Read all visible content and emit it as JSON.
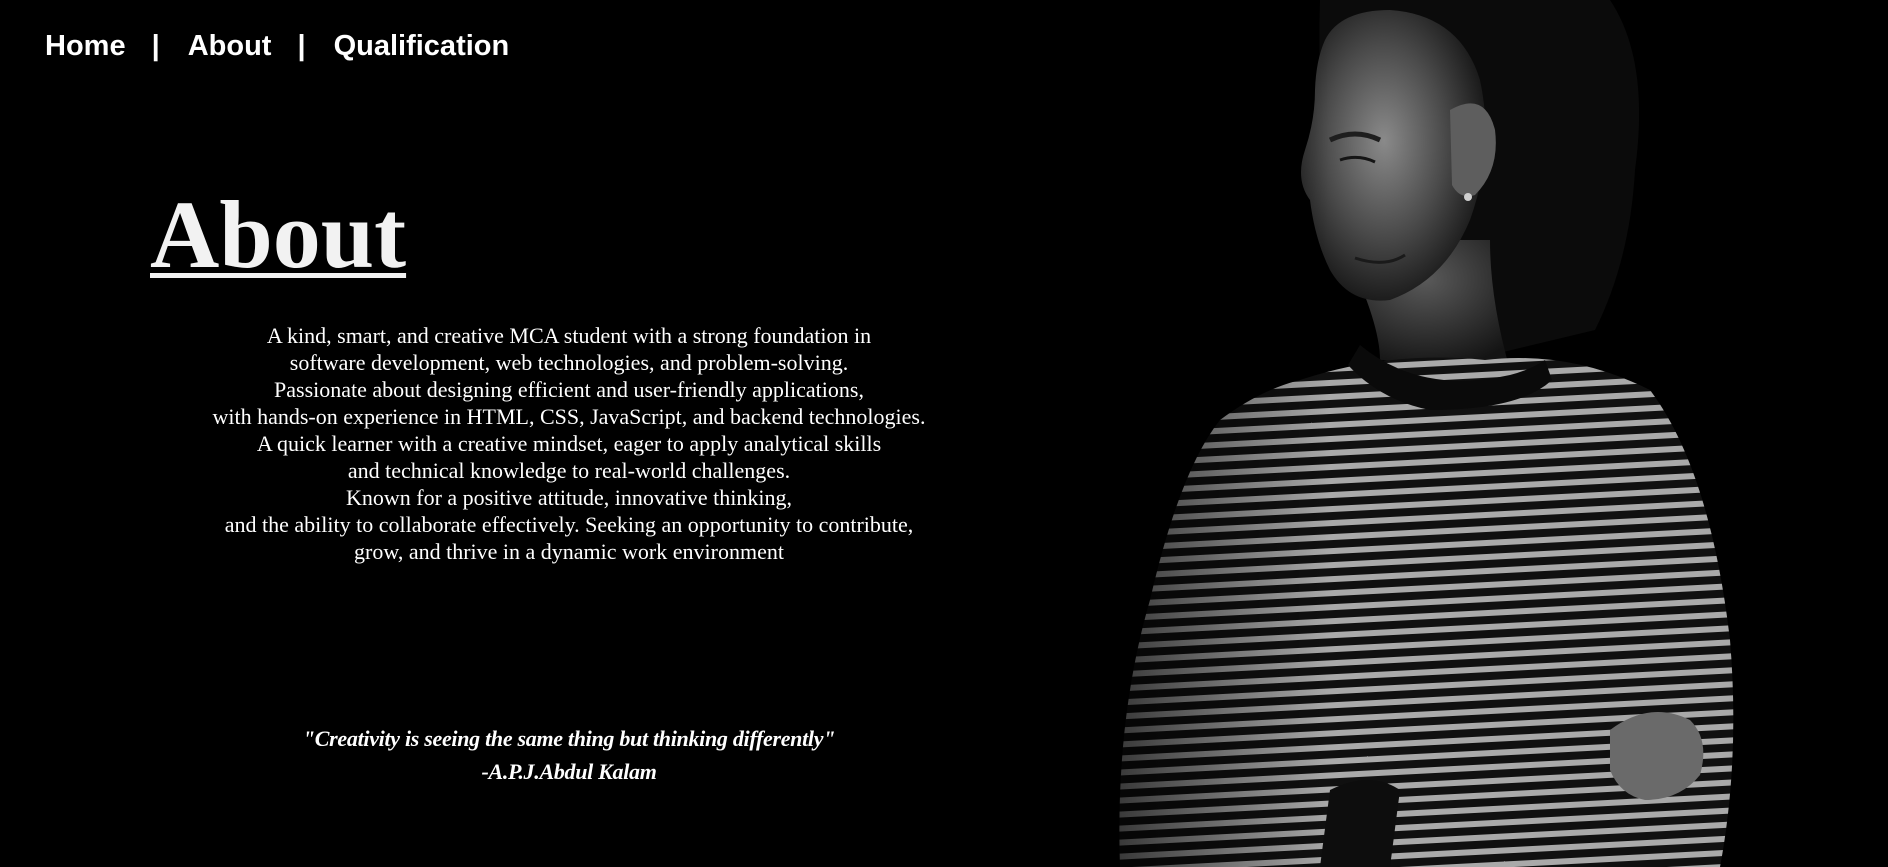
{
  "nav": {
    "items": [
      {
        "label": "Home"
      },
      {
        "label": "About"
      },
      {
        "label": "Qualification"
      }
    ],
    "separator": "|"
  },
  "about": {
    "title": "About",
    "lines": [
      "A kind, smart, and creative MCA student with a strong foundation in",
      "software development, web technologies, and problem-solving.",
      "Passionate about designing efficient and user-friendly applications,",
      "with hands-on experience in HTML, CSS, JavaScript, and backend technologies.",
      "A quick learner with a creative mindset, eager to apply analytical skills",
      "and technical knowledge to real-world challenges.",
      "Known for a positive attitude, innovative thinking,",
      "and the ability to collaborate effectively. Seeking an opportunity to contribute,",
      "grow, and thrive in a dynamic work environment"
    ]
  },
  "quote": {
    "text": "\"Creativity is seeing the same thing but thinking differently\"",
    "author": "-A.P.J.Abdul Kalam"
  },
  "colors": {
    "background": "#000000",
    "text": "#ffffff"
  }
}
